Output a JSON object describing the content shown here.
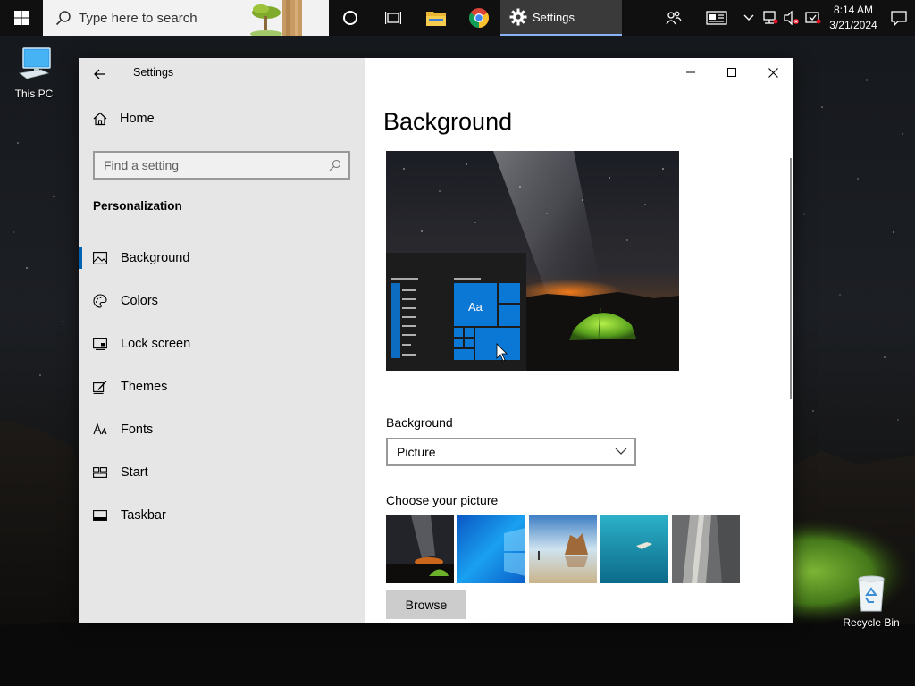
{
  "taskbar": {
    "search_placeholder": "Type here to search",
    "active_app_label": "Settings",
    "clock_time": "8:14 AM",
    "clock_date": "3/21/2024"
  },
  "desktop": {
    "this_pc_label": "This PC",
    "recycle_bin_label": "Recycle Bin"
  },
  "settings": {
    "app_title": "Settings",
    "home_label": "Home",
    "find_placeholder": "Find a setting",
    "section_title": "Personalization",
    "nav": [
      {
        "label": "Background",
        "icon": "picture-icon",
        "active": true
      },
      {
        "label": "Colors",
        "icon": "palette-icon"
      },
      {
        "label": "Lock screen",
        "icon": "lock-screen-icon"
      },
      {
        "label": "Themes",
        "icon": "themes-icon"
      },
      {
        "label": "Fonts",
        "icon": "fonts-icon"
      },
      {
        "label": "Start",
        "icon": "start-icon"
      },
      {
        "label": "Taskbar",
        "icon": "taskbar-icon"
      }
    ],
    "page_title": "Background",
    "preview_tile_text": "Aa",
    "background_label": "Background",
    "background_value": "Picture",
    "choose_picture_label": "Choose your picture",
    "browse_label": "Browse"
  },
  "colors": {
    "accent": "#0078d7",
    "sidebar_bg": "#e6e6e6",
    "taskbar_bg": "#101010"
  }
}
